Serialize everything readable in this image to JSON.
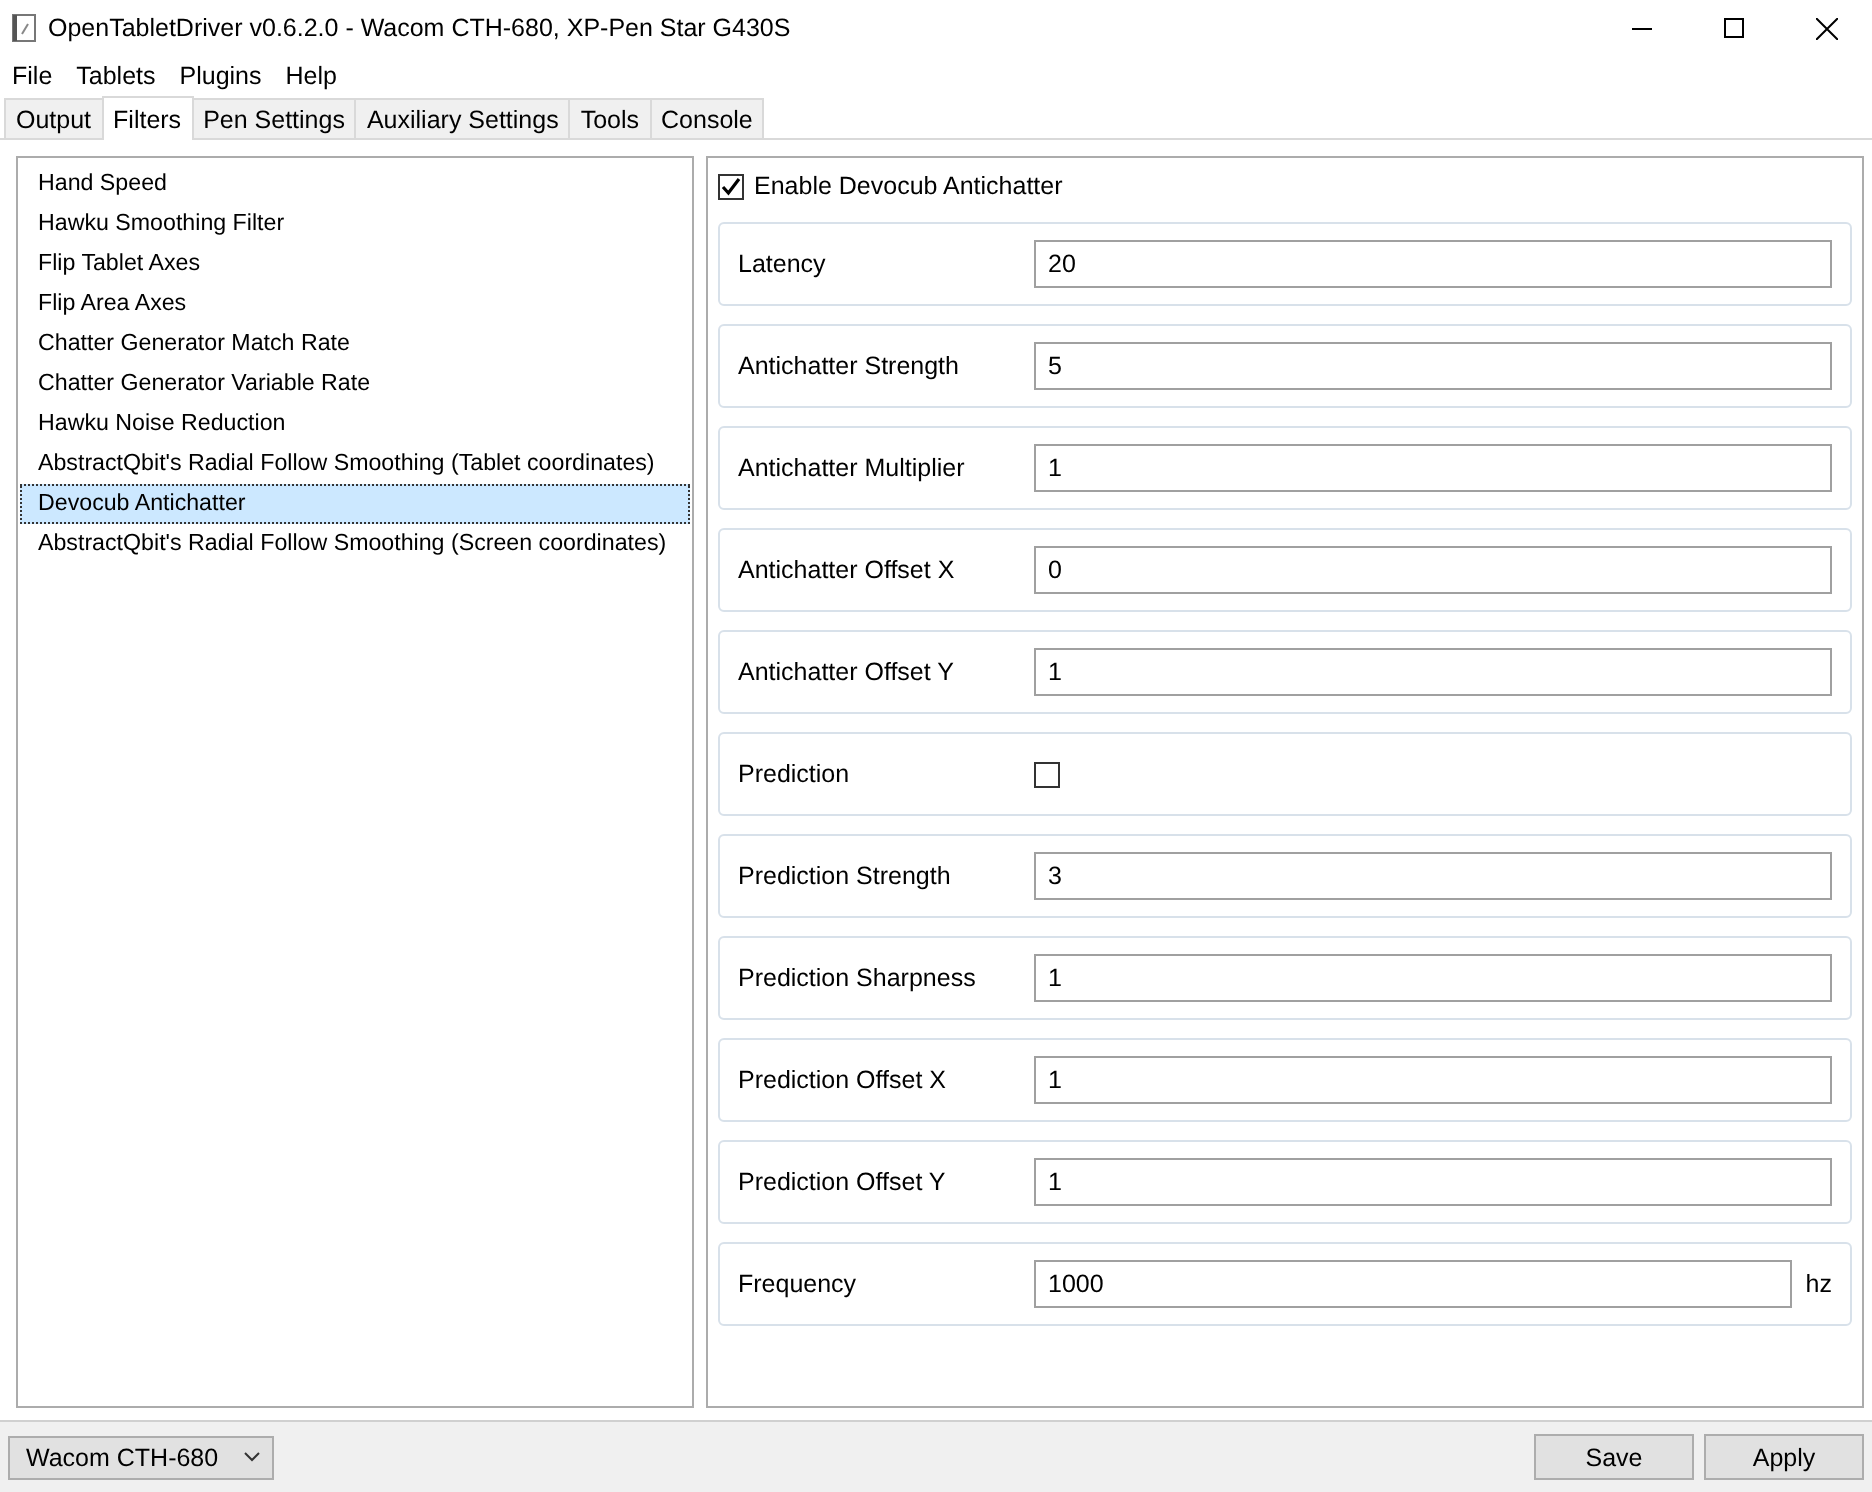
{
  "window": {
    "title": "OpenTabletDriver v0.6.2.0 - Wacom CTH-680, XP-Pen Star G430S"
  },
  "menu": [
    "File",
    "Tablets",
    "Plugins",
    "Help"
  ],
  "tabs": [
    {
      "label": "Output",
      "selected": false
    },
    {
      "label": "Filters",
      "selected": true
    },
    {
      "label": "Pen Settings",
      "selected": false
    },
    {
      "label": "Auxiliary Settings",
      "selected": false
    },
    {
      "label": "Tools",
      "selected": false
    },
    {
      "label": "Console",
      "selected": false
    }
  ],
  "filters": [
    {
      "label": "Hand Speed",
      "selected": false
    },
    {
      "label": "Hawku Smoothing Filter",
      "selected": false
    },
    {
      "label": "Flip Tablet Axes",
      "selected": false
    },
    {
      "label": "Flip Area Axes",
      "selected": false
    },
    {
      "label": "Chatter Generator Match Rate",
      "selected": false
    },
    {
      "label": "Chatter Generator Variable Rate",
      "selected": false
    },
    {
      "label": "Hawku Noise Reduction",
      "selected": false
    },
    {
      "label": "AbstractQbit's Radial Follow Smoothing (Tablet coordinates)",
      "selected": false
    },
    {
      "label": "Devocub Antichatter",
      "selected": true
    },
    {
      "label": "AbstractQbit's Radial Follow Smoothing (Screen coordinates)",
      "selected": false
    }
  ],
  "enable": {
    "label": "Enable Devocub Antichatter",
    "checked": true
  },
  "settings": [
    {
      "kind": "text",
      "label": "Latency",
      "value": "20"
    },
    {
      "kind": "text",
      "label": "Antichatter Strength",
      "value": "5"
    },
    {
      "kind": "text",
      "label": "Antichatter Multiplier",
      "value": "1"
    },
    {
      "kind": "text",
      "label": "Antichatter Offset X",
      "value": "0"
    },
    {
      "kind": "text",
      "label": "Antichatter Offset Y",
      "value": "1"
    },
    {
      "kind": "check",
      "label": "Prediction",
      "checked": false
    },
    {
      "kind": "text",
      "label": "Prediction Strength",
      "value": "3"
    },
    {
      "kind": "text",
      "label": "Prediction Sharpness",
      "value": "1"
    },
    {
      "kind": "text",
      "label": "Prediction Offset X",
      "value": "1"
    },
    {
      "kind": "text",
      "label": "Prediction Offset Y",
      "value": "1"
    },
    {
      "kind": "text",
      "label": "Frequency",
      "value": "1000",
      "unit": "hz"
    }
  ],
  "footer": {
    "tablet": "Wacom CTH-680",
    "buttons": [
      "Save",
      "Apply"
    ]
  }
}
